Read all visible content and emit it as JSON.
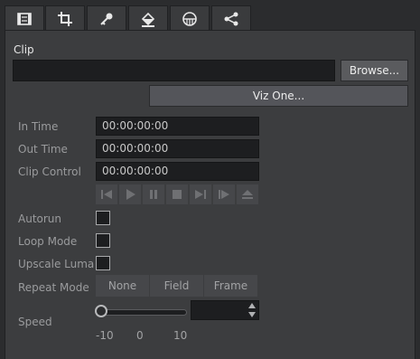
{
  "tabs": [
    {
      "icon": "clip-icon"
    },
    {
      "icon": "crop-icon"
    },
    {
      "icon": "key-icon"
    },
    {
      "icon": "fill-icon"
    },
    {
      "icon": "mask-icon"
    },
    {
      "icon": "share-icon"
    }
  ],
  "clip": {
    "label": "Clip",
    "path_value": "",
    "browse_label": "Browse...",
    "vizone_label": "Viz One..."
  },
  "fields": {
    "in_time_label": "In Time",
    "in_time_value": "00:00:00:00",
    "out_time_label": "Out Time",
    "out_time_value": "00:00:00:00",
    "clip_control_label": "Clip Control",
    "clip_control_value": "00:00:00:00"
  },
  "transport": [
    "skip-to-start-icon",
    "play-icon",
    "pause-icon",
    "stop-icon",
    "skip-to-end-icon",
    "step-forward-icon",
    "eject-icon"
  ],
  "options": {
    "autorun_label": "Autorun",
    "autorun_checked": false,
    "loop_label": "Loop Mode",
    "loop_checked": false,
    "upscale_label": "Upscale Luma",
    "upscale_checked": false
  },
  "repeat": {
    "label": "Repeat Mode",
    "options": [
      "None",
      "Field",
      "Frame"
    ]
  },
  "speed": {
    "label": "Speed",
    "value": "",
    "slider_min": -10,
    "slider_max": 10,
    "ticks": [
      "-10",
      "0",
      "10"
    ]
  },
  "colors": {
    "background": "#2b2c2e",
    "panel": "#3c3d3f",
    "field": "#1d1e20",
    "button": "#5a5b5e"
  }
}
